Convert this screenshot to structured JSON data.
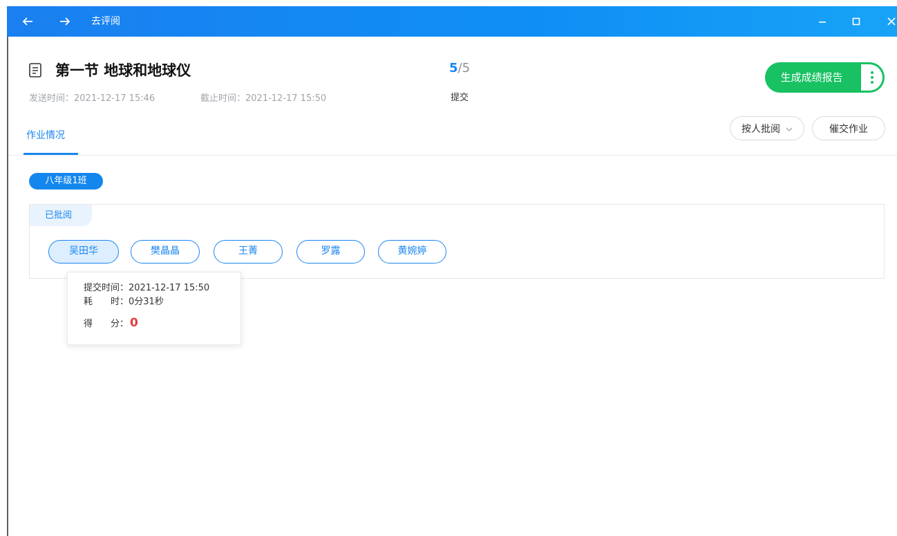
{
  "window": {
    "title": "去评阅",
    "back_icon": "arrow-left-icon",
    "forward_icon": "arrow-right-icon",
    "controls": [
      "minimize-icon",
      "maximize-icon",
      "close-icon"
    ]
  },
  "header": {
    "title": "第一节 地球和地球仪",
    "send_time": "发送时间：2021-12-17 15:46",
    "deadline": "截止时间：2021-12-17 15:50",
    "submitted": "5",
    "separator": "/",
    "total": "5",
    "submitted_label": "提交",
    "report_button": "生成成绩报告"
  },
  "tabs": [
    {
      "label": "作业情况",
      "active": true
    }
  ],
  "toolbar": {
    "sort_label": "按人批阅",
    "remind_label": "催交作业"
  },
  "class_tag": "八年级1班",
  "status_group": "已批阅",
  "students": [
    {
      "name": "吴田华",
      "active": true
    },
    {
      "name": "樊晶晶",
      "active": false
    },
    {
      "name": "王菁",
      "active": false
    },
    {
      "name": "罗露",
      "active": false
    },
    {
      "name": "黄婉婷",
      "active": false
    }
  ],
  "tooltip": {
    "submit_time_label": "提交时间：",
    "submit_time": "2021-12-17 15:50",
    "duration_label": "耗　　时：",
    "duration": "0分31秒",
    "score_label": "得　　分：",
    "score": "0"
  },
  "colors": {
    "accent": "#1a86f0",
    "report_green": "#18c162",
    "score_red": "#e4393c",
    "titlebar": "#1a7ff0"
  }
}
